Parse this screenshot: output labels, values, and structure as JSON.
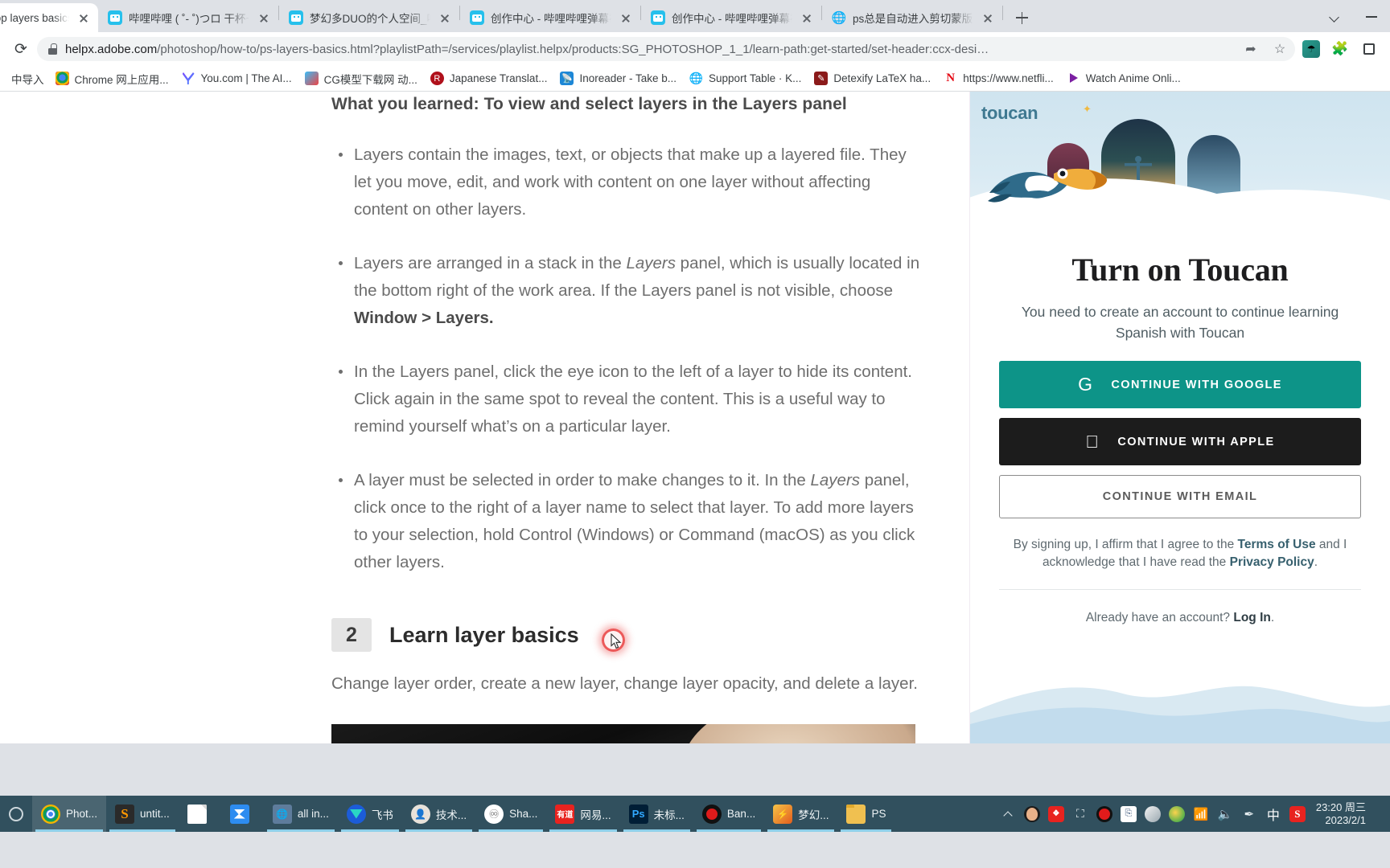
{
  "window": {
    "controls": {
      "search_tabs": "chevron-down-icon",
      "minimize": "minimize-icon"
    }
  },
  "tabs": [
    {
      "title": "oshop layers basics",
      "favicon": "none",
      "active": true
    },
    {
      "title": "哔哩哔哩 ( ˚- ˚)つロ 干杯~",
      "favicon": "bilibili-icon",
      "active": false
    },
    {
      "title": "梦幻多DUO的个人空间_哔哩",
      "favicon": "bilibili-icon",
      "active": false
    },
    {
      "title": "创作中心 - 哔哩哔哩弹幕视",
      "favicon": "bilibili-icon",
      "active": false
    },
    {
      "title": "创作中心 - 哔哩哔哩弹幕视",
      "favicon": "bilibili-icon",
      "active": false
    },
    {
      "title": "ps总是自动进入剪切蒙版模",
      "favicon": "globe-icon",
      "active": false
    }
  ],
  "toolbar": {
    "reload_label": "⟳",
    "url_host": "helpx.adobe.com",
    "url_path": "/photoshop/how-to/ps-layers-basics.html?playlistPath=/services/playlist.helpx/products:SG_PHOTOSHOP_1_1/learn-path:get-started/set-header:ccx-desi…",
    "share_icon": "share-icon",
    "bookmark_icon": "star-icon",
    "extension_icon": "extension-icon",
    "puzzle_icon": "puzzle-icon",
    "sidepanel_icon": "side-panel-icon"
  },
  "bookmarks": {
    "import_label": "中导入",
    "items": [
      {
        "label": "Chrome 网上应用...",
        "favicon": "chrome-store-icon"
      },
      {
        "label": "You.com | The AI...",
        "favicon": "you-com-icon"
      },
      {
        "label": "CG模型下载网 动...",
        "favicon": "cg-model-icon"
      },
      {
        "label": "Japanese Translat...",
        "favicon": "japanese-translate-icon"
      },
      {
        "label": "Inoreader - Take b...",
        "favicon": "inoreader-icon"
      },
      {
        "label": "Support Table · K...",
        "favicon": "globe-icon"
      },
      {
        "label": "Detexify LaTeX ha...",
        "favicon": "detexify-icon"
      },
      {
        "label": "https://www.netfli...",
        "favicon": "netflix-icon"
      },
      {
        "label": "Watch Anime Onli...",
        "favicon": "anime-icon"
      }
    ]
  },
  "article": {
    "learned_heading": "What you learned: To view and select layers in the Layers panel",
    "bullets": [
      "Layers contain the images, text, or objects that make up a layered file. They let you move, edit, and work with content on one layer without affecting content on other layers.",
      "Layers are arranged in a stack in the <i>Layers</i> panel, which is usually located in the bottom right of the work area. If the Layers panel is not visible, choose <b>Window &gt; Layers.</b>",
      "In the Layers panel, click the eye icon to the left of a layer to hide its content. Click again in the same spot to reveal the content. This is a useful way to remind yourself what’s on a particular layer.",
      "A layer must be selected in order to make changes to it. In the <i>Layers</i> panel, click once to the right of a layer name to select that layer. To add more layers to your selection, hold Control (Windows) or Command (macOS) as you click other layers."
    ],
    "step_number": "2",
    "step_title": "Learn layer basics",
    "step_description": "Change layer order, create a new layer, change layer opacity, and delete a layer."
  },
  "ad_panel": {
    "logo": "toucan",
    "heading": "Turn on Toucan",
    "subheading": "You need to create an account to continue learning Spanish with Toucan",
    "btn_google": "CONTINUE WITH GOOGLE",
    "btn_apple": "CONTINUE WITH APPLE",
    "btn_email": "CONTINUE WITH EMAIL",
    "legal_prefix": "By signing up, I affirm that I agree to the ",
    "legal_terms": "Terms of Use",
    "legal_middle": " and I acknowledge that I have read the ",
    "legal_privacy": "Privacy Policy",
    "legal_suffix": ".",
    "login_prefix": "Already have an account? ",
    "login_link": "Log In",
    "login_suffix": "."
  },
  "taskbar": {
    "items": [
      {
        "label": "Phot...",
        "icon": "chrome-icon",
        "active": true
      },
      {
        "label": "untit...",
        "icon": "sublime-text-icon",
        "active": false
      },
      {
        "label": "",
        "icon": "document-icon",
        "active": false
      },
      {
        "label": "",
        "icon": "blue-app-icon",
        "active": false
      },
      {
        "label": "all in...",
        "icon": "all-in-one-icon",
        "active": false
      },
      {
        "label": "飞书",
        "icon": "feishu-icon",
        "active": false
      },
      {
        "label": "技术...",
        "icon": "avatar-icon",
        "active": false
      },
      {
        "label": "Sha...",
        "icon": "share-app-icon",
        "active": false
      },
      {
        "label": "网易...",
        "icon": "youdao-icon",
        "active": false
      },
      {
        "label": "未标...",
        "icon": "photoshop-icon",
        "active": false
      },
      {
        "label": "Ban...",
        "icon": "bandicam-icon",
        "active": false
      },
      {
        "label": "梦幻...",
        "icon": "menghuan-icon",
        "active": false
      },
      {
        "label": "PS",
        "icon": "folder-icon",
        "active": false
      }
    ],
    "tray": [
      {
        "icon": "tray-expand-chevron-icon"
      },
      {
        "icon": "qq-icon"
      },
      {
        "icon": "red-app-icon"
      },
      {
        "icon": "screen-capture-icon"
      },
      {
        "icon": "record-icon"
      },
      {
        "icon": "screenshot-frame-icon"
      },
      {
        "icon": "globe-tray-icon"
      },
      {
        "icon": "green-game-icon"
      },
      {
        "icon": "wifi-icon"
      },
      {
        "icon": "volume-icon"
      },
      {
        "icon": "pen-icon"
      },
      {
        "icon": "ime-chinese-icon"
      },
      {
        "icon": "sogou-icon"
      }
    ],
    "clock_time": "23:20 周三",
    "clock_date": "2023/2/1"
  }
}
